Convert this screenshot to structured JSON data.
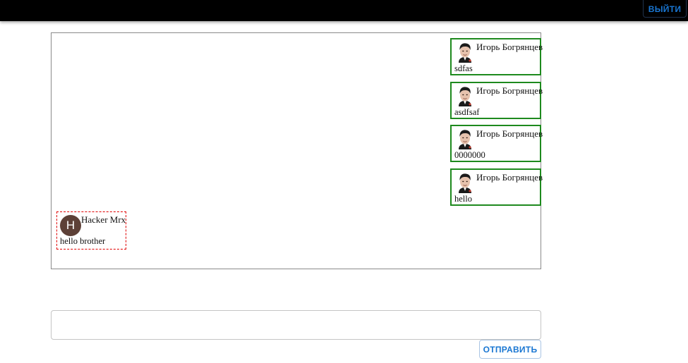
{
  "header": {
    "logout_label": "ВЫЙТИ"
  },
  "chat": {
    "outgoing": [
      {
        "author": "Игорь Богрянцев",
        "text": "sdfas",
        "avatar": "user-photo"
      },
      {
        "author": "Игорь Богрянцев",
        "text": "asdfsaf",
        "avatar": "user-photo"
      },
      {
        "author": "Игорь Богрянцев",
        "text": "0000000",
        "avatar": "user-photo"
      },
      {
        "author": "Игорь Богрянцев",
        "text": "hello",
        "avatar": "user-photo"
      }
    ],
    "incoming": [
      {
        "author": "Hacker Mrx",
        "text": "hello brother",
        "avatar_letter": "H"
      }
    ]
  },
  "composer": {
    "value": "",
    "send_label": "ОТПРАВИТЬ"
  },
  "colors": {
    "topbar": "#000000",
    "accent": "#1976d2",
    "own_message_border": "#1e8a1e",
    "other_message_border": "#e00000",
    "letter_avatar_bg": "#5d4037"
  }
}
